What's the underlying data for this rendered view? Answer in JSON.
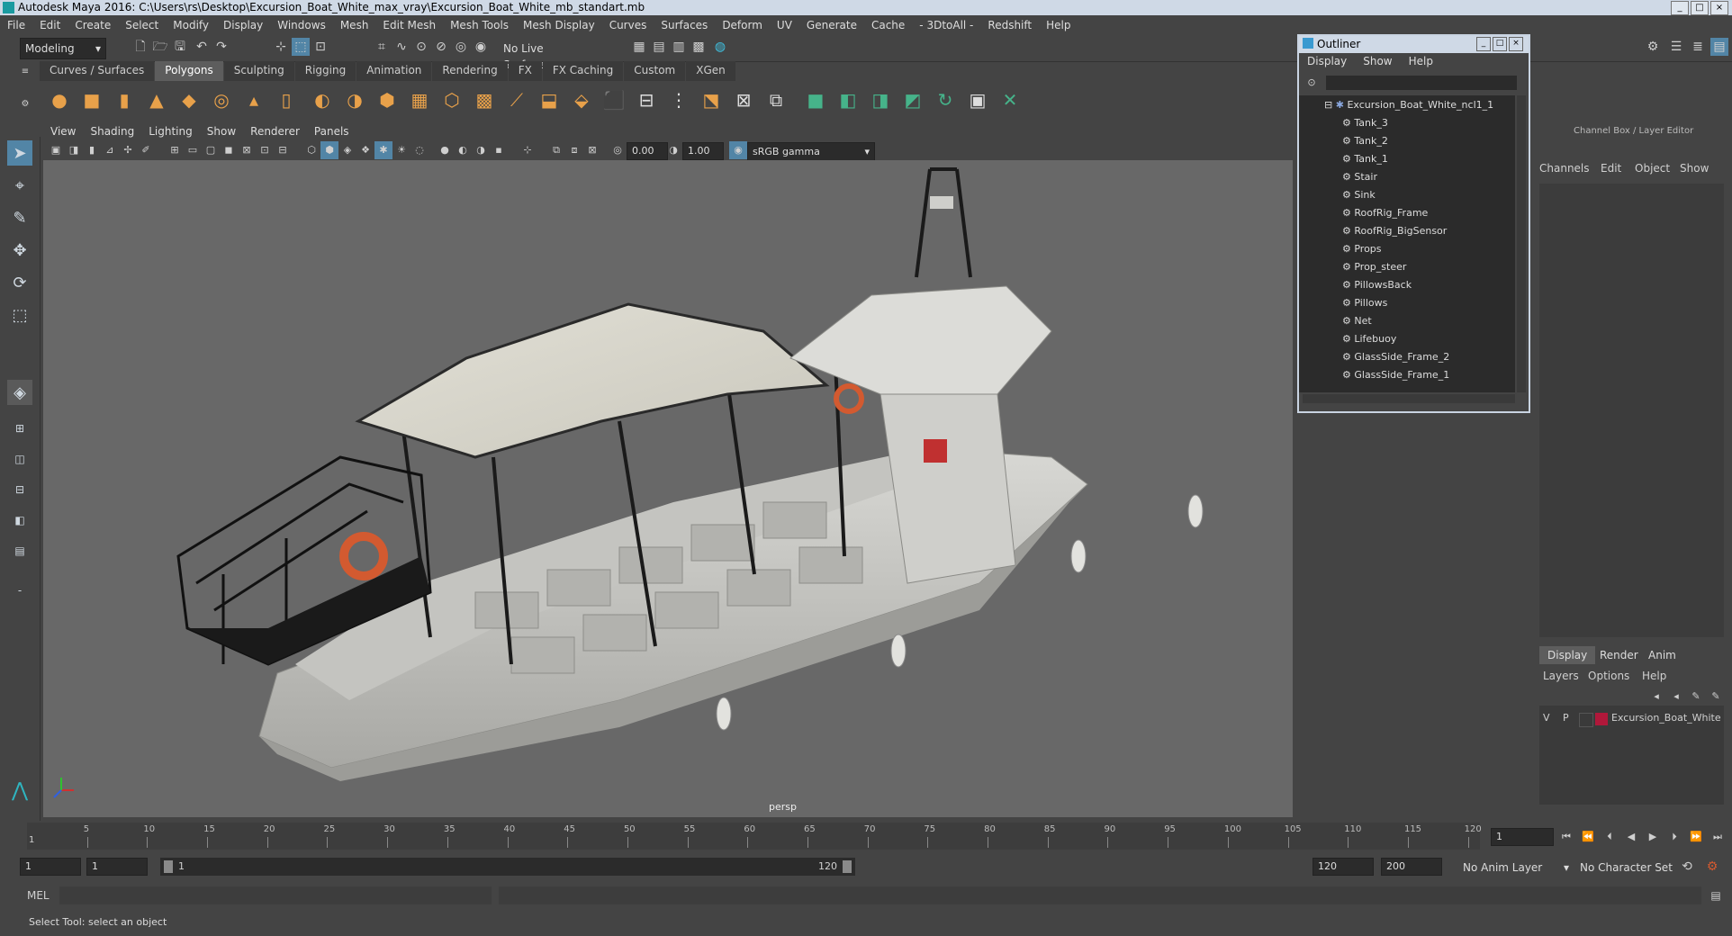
{
  "window": {
    "title": "Autodesk Maya 2016: C:\\Users\\rs\\Desktop\\Excursion_Boat_White_max_vray\\Excursion_Boat_White_mb_standart.mb",
    "buttons": [
      "_",
      "□",
      "×"
    ]
  },
  "menubar": [
    "File",
    "Edit",
    "Create",
    "Select",
    "Modify",
    "Display",
    "Windows",
    "Mesh",
    "Edit Mesh",
    "Mesh Tools",
    "Mesh Display",
    "Curves",
    "Surfaces",
    "Deform",
    "UV",
    "Generate",
    "Cache",
    "- 3DtoAll -",
    "Redshift",
    "Help"
  ],
  "statusline": {
    "mode": "Modeling",
    "live_surface": "No Live Surface"
  },
  "shelf_tabs": [
    {
      "label": "Curves / Surfaces",
      "active": false
    },
    {
      "label": "Polygons",
      "active": true
    },
    {
      "label": "Sculpting",
      "active": false
    },
    {
      "label": "Rigging",
      "active": false
    },
    {
      "label": "Animation",
      "active": false
    },
    {
      "label": "Rendering",
      "active": false
    },
    {
      "label": "FX",
      "active": false
    },
    {
      "label": "FX Caching",
      "active": false
    },
    {
      "label": "Custom",
      "active": false
    },
    {
      "label": "XGen",
      "active": false
    }
  ],
  "panel_menu": [
    "View",
    "Shading",
    "Lighting",
    "Show",
    "Renderer",
    "Panels"
  ],
  "panel_toolbar": {
    "exposure": "0.00",
    "gamma": "1.00",
    "color_space": "sRGB gamma"
  },
  "viewport": {
    "camera_label": "persp"
  },
  "outliner": {
    "title": "Outliner",
    "menu": [
      "Display",
      "Show",
      "Help"
    ],
    "root": "Excursion_Boat_White_ncl1_1",
    "items": [
      "Tank_3",
      "Tank_2",
      "Tank_1",
      "Stair",
      "Sink",
      "RoofRig_Frame",
      "RoofRig_BigSensor",
      "Props",
      "Prop_steer",
      "PillowsBack",
      "Pillows",
      "Net",
      "Lifebuoy",
      "GlassSide_Frame_2",
      "GlassSide_Frame_1"
    ]
  },
  "channel_box": {
    "title": "Channel Box / Layer Editor",
    "menu": [
      "Channels",
      "Edit",
      "Object",
      "Show"
    ],
    "layer_tabs": [
      "Display",
      "Render",
      "Anim"
    ],
    "layer_menu": [
      "Layers",
      "Options",
      "Help"
    ],
    "layer": {
      "v": "V",
      "p": "P",
      "name": "Excursion_Boat_White",
      "color": "#b0183a"
    }
  },
  "timeline": {
    "ticks": [
      "5",
      "10",
      "15",
      "20",
      "25",
      "30",
      "35",
      "40",
      "45",
      "50",
      "55",
      "60",
      "65",
      "70",
      "75",
      "80",
      "85",
      "90",
      "95",
      "100",
      "105",
      "110",
      "115",
      "120"
    ],
    "current_frame": "1",
    "start_marker": "1"
  },
  "range": {
    "start": "1",
    "anim_start": "1",
    "slider_start": "1",
    "slider_end": "120",
    "end": "120",
    "anim_end": "200",
    "anim_layer": "No Anim Layer",
    "char_set": "No Character Set"
  },
  "cmdline": {
    "label": "MEL"
  },
  "helpline": {
    "text": "Select Tool: select an object"
  },
  "colors": {
    "accent": "#5285a6",
    "shelf_orange": "#e8a14a",
    "shelf_green": "#46b38a"
  }
}
